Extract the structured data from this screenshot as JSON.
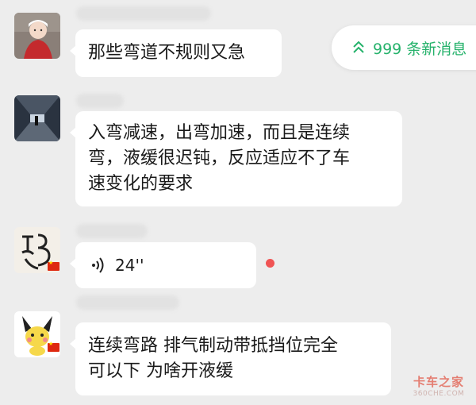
{
  "banner": {
    "new_messages": "999 条新消息"
  },
  "messages": [
    {
      "text_lines": [
        "那些弯道不规则又急"
      ]
    },
    {
      "text_lines": [
        "入弯减速，出弯加速，而且是连续",
        "弯，液缓很迟钝，反应适应不了车",
        "速变化的要求"
      ]
    },
    {
      "voice_duration": "24''"
    },
    {
      "text_lines": [
        "连续弯路  排气制动带抵挡位完全",
        "可以下  为啥开液缓"
      ]
    }
  ],
  "watermark": {
    "brand": "卡车之家",
    "domain": "360CHE.COM"
  },
  "colors": {
    "background": "#ededed",
    "bubble": "#ffffff",
    "accent_green": "#25b26b",
    "unread_dot": "#f05454"
  }
}
